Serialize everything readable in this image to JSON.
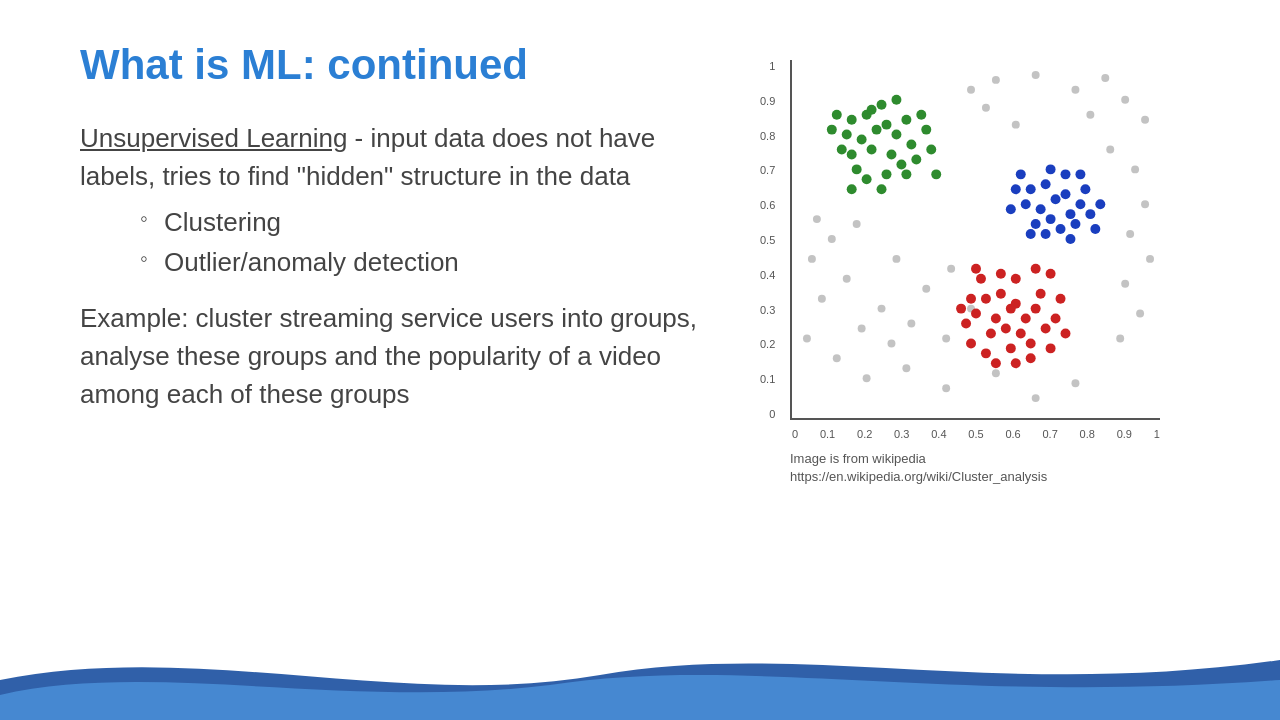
{
  "slide": {
    "title": "What is ML: continued",
    "unsupervised_label": "Unsupervised Learning",
    "unsupervised_desc": " - input data does not have labels, tries to find \"hidden\" structure in the data",
    "bullets": [
      "Clustering",
      "Outlier/anomaly detection"
    ],
    "example_text": "Example: cluster streaming service users into groups, analyse these groups and the popularity of a video among each of these groups",
    "chart_caption": "Image is from wikipedia https://en.wikipedia.org/wiki/Cluster_analysis",
    "y_labels": [
      "1",
      "0.9",
      "0.8",
      "0.7",
      "0.6",
      "0.5",
      "0.4",
      "0.3",
      "0.2",
      "0.1",
      "0"
    ],
    "x_labels": [
      "0",
      "0.1",
      "0.2",
      "0.3",
      "0.4",
      "0.5",
      "0.6",
      "0.7",
      "0.8",
      "0.9",
      "1"
    ]
  },
  "colors": {
    "title": "#2B7FD4",
    "text": "#444444",
    "green_cluster": "#2E8B2E",
    "blue_cluster": "#1A3EBF",
    "red_cluster": "#CC2222",
    "gray_noise": "#AAAAAA",
    "wave_dark": "#1A4FA0",
    "wave_light": "#4A90D9"
  }
}
